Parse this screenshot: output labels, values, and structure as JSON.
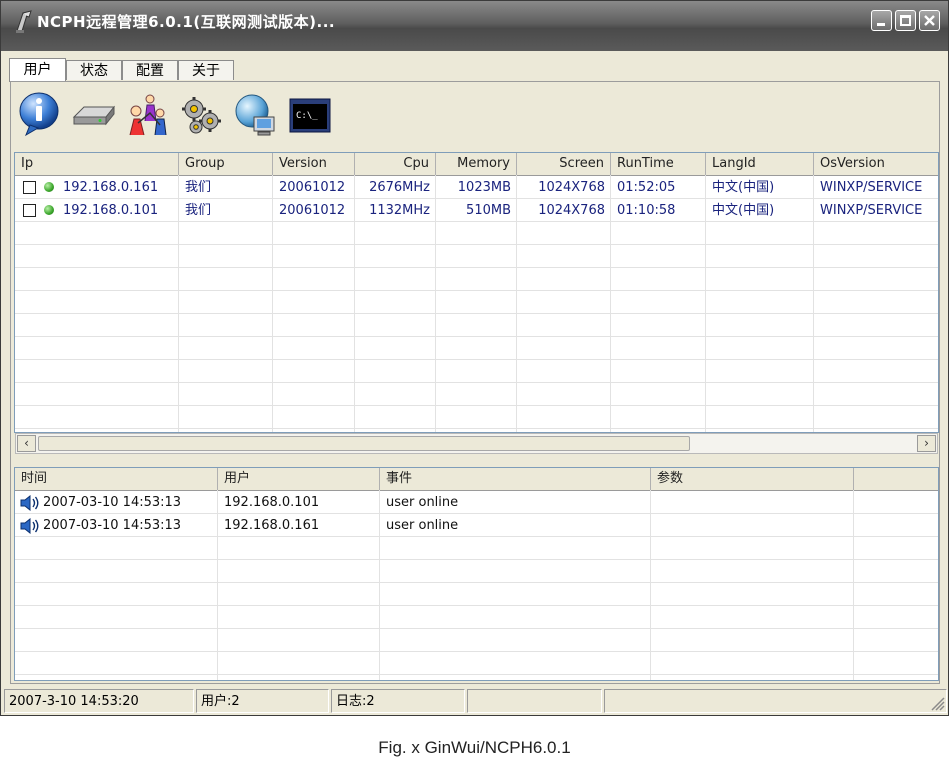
{
  "window": {
    "title": "NCPH远程管理6.0.1(互联网测试版本)...",
    "controls": {
      "minimize_icon": "minimize-icon",
      "maximize_icon": "maximize-icon",
      "close_icon": "close-icon"
    }
  },
  "tabs": [
    {
      "label": "用户",
      "active": true
    },
    {
      "label": "状态",
      "active": false
    },
    {
      "label": "配置",
      "active": false
    },
    {
      "label": "关于",
      "active": false
    }
  ],
  "toolbar": {
    "buttons": [
      {
        "icon": "info-icon"
      },
      {
        "icon": "drive-icon"
      },
      {
        "icon": "users-icon"
      },
      {
        "icon": "settings-gears-icon"
      },
      {
        "icon": "network-computer-icon"
      },
      {
        "icon": "command-prompt-icon",
        "text": "C:\\_"
      }
    ]
  },
  "clients": {
    "columns": [
      "Ip",
      "Group",
      "Version",
      "Cpu",
      "Memory",
      "Screen",
      "RunTime",
      "LangId",
      "OsVersion"
    ],
    "rows": [
      {
        "ip": "192.168.0.161",
        "group": "我们",
        "version": "20061012",
        "cpu": "2676MHz",
        "memory": "1023MB",
        "screen": "1024X768",
        "runtime": "01:52:05",
        "langid": "中文(中国)",
        "osversion": "WINXP/SERVICE"
      },
      {
        "ip": "192.168.0.101",
        "group": "我们",
        "version": "20061012",
        "cpu": "1132MHz",
        "memory": "510MB",
        "screen": "1024X768",
        "runtime": "01:10:58",
        "langid": "中文(中国)",
        "osversion": "WINXP/SERVICE"
      }
    ]
  },
  "log": {
    "columns": [
      "时间",
      "用户",
      "事件",
      "参数"
    ],
    "rows": [
      {
        "time": "2007-03-10 14:53:13",
        "user": "192.168.0.101",
        "event": "user online",
        "param": ""
      },
      {
        "time": "2007-03-10 14:53:13",
        "user": "192.168.0.161",
        "event": "user online",
        "param": ""
      }
    ]
  },
  "statusbar": {
    "datetime": "2007-3-10 14:53:20",
    "users": "用户:2",
    "logs": "日志:2"
  },
  "caption": "Fig. x GinWui/NCPH6.0.1",
  "colors": {
    "titlebar": "#5e5e5e",
    "face": "#ece9d8",
    "row_text": "#1a237e",
    "online_dot": "#3aa52a"
  }
}
